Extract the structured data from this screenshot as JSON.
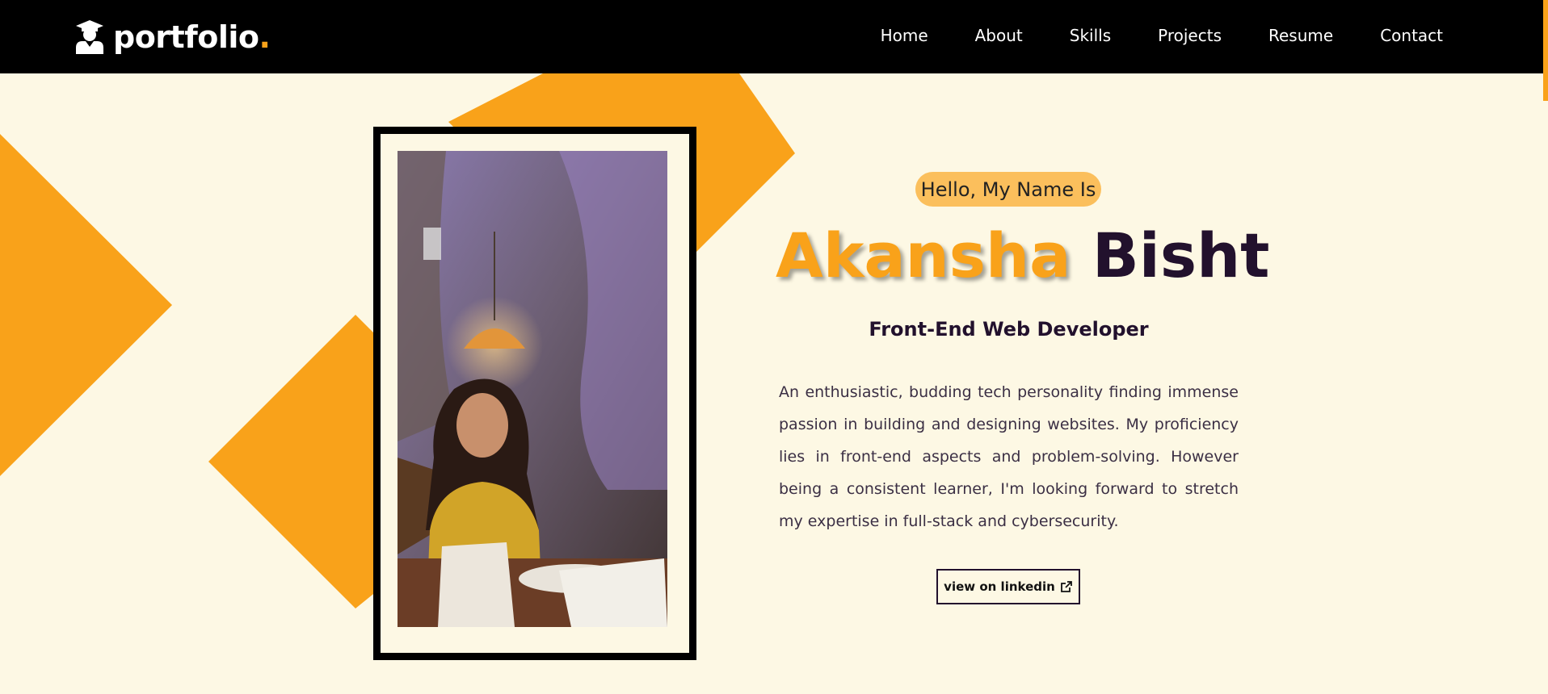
{
  "brand": {
    "name": "portfolio",
    "dot": "."
  },
  "nav": {
    "items": [
      {
        "label": "Home"
      },
      {
        "label": "About"
      },
      {
        "label": "Skills"
      },
      {
        "label": "Projects"
      },
      {
        "label": "Resume"
      },
      {
        "label": "Contact"
      }
    ]
  },
  "hero": {
    "greeting": "Hello, My Name Is",
    "first_name": "Akansha",
    "last_name": "Bisht",
    "role": "Front-End Web Developer",
    "bio": "An enthusiastic, budding tech personality finding immense passion in building and designing websites. My proficiency lies in front-end aspects and problem-solving. However being a consistent learner, I'm looking forward to stretch my expertise in full-stack and cybersecurity.",
    "button_label": "view on linkedin"
  },
  "icons": {
    "brand": "graduate-icon",
    "button": "external-link-icon"
  },
  "colors": {
    "accent": "#f9a21a",
    "background": "#fdf8e4",
    "navbar": "#000000",
    "text_dark": "#22112d",
    "greeting_pill": "#fbbf5c"
  }
}
